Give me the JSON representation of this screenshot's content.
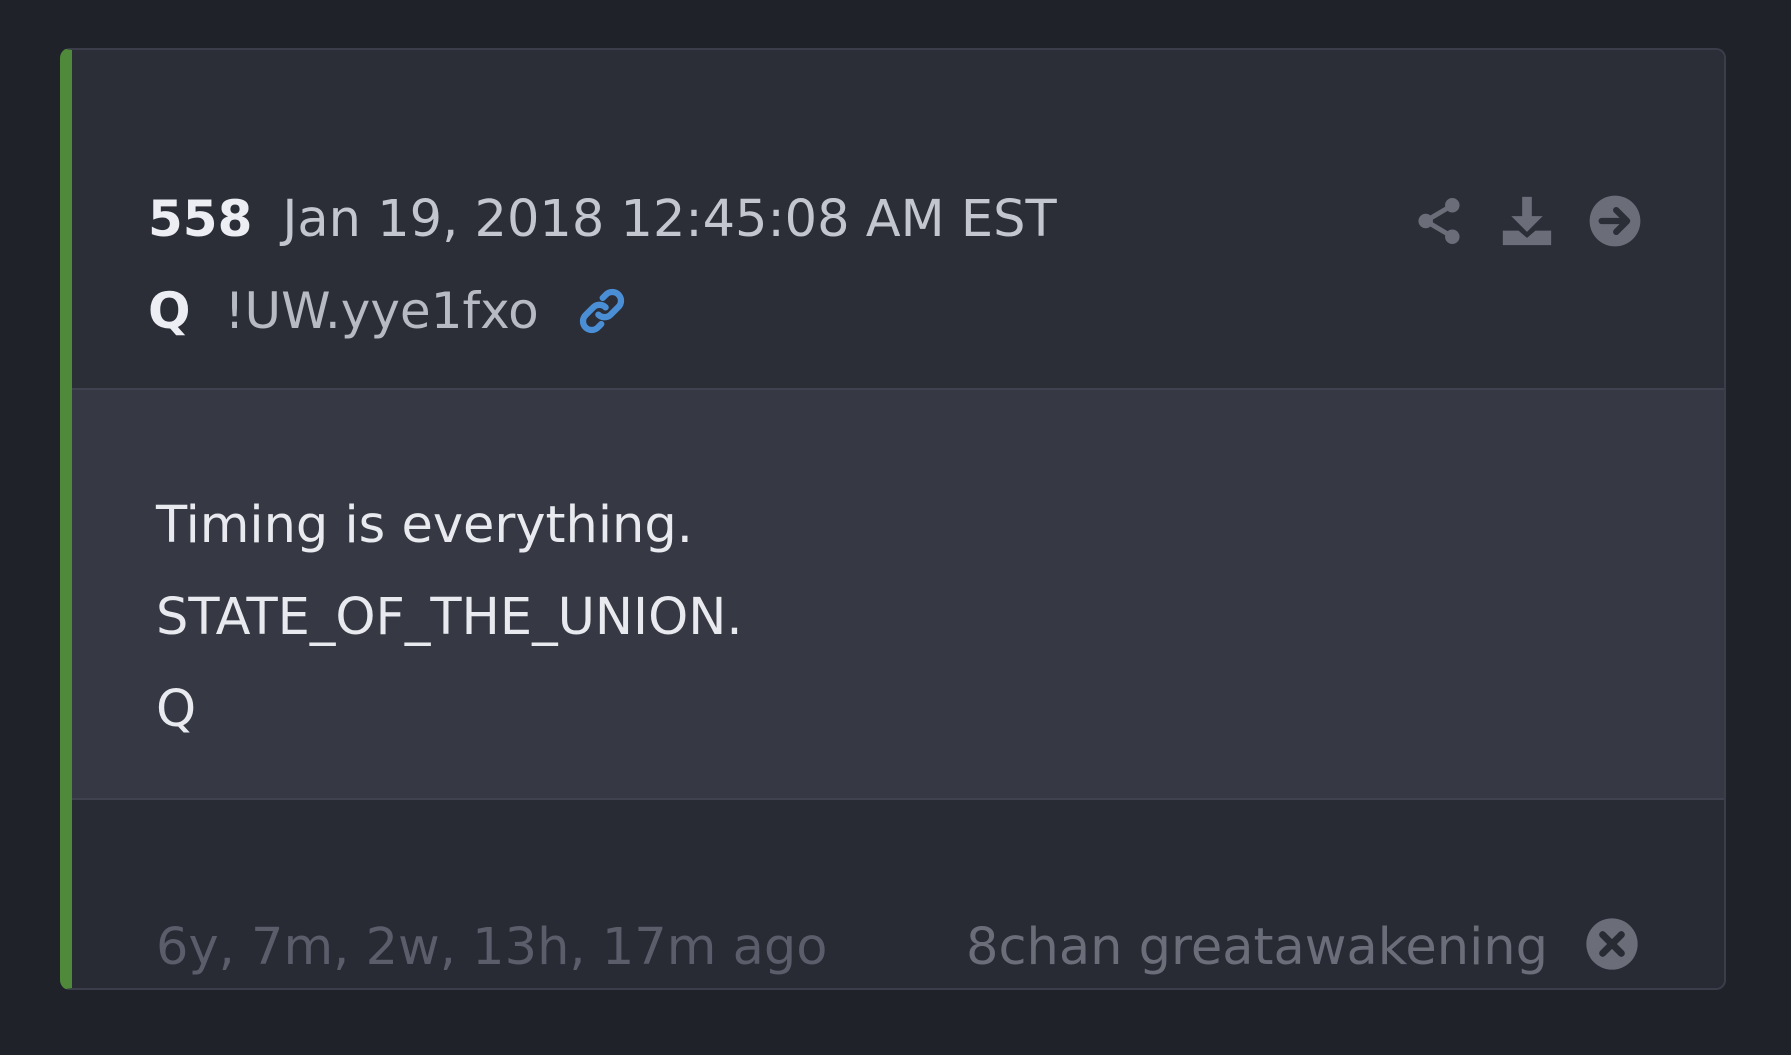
{
  "post": {
    "number": "558",
    "date": "Jan 19, 2018 12:45:08 AM EST",
    "author": "Q",
    "tripcode": "!UW.yye1fxo",
    "body_lines": [
      "Timing is everything.",
      "STATE_OF_THE_UNION.",
      "Q"
    ],
    "age": "6y, 7m, 2w, 13h, 17m ago",
    "source": "8chan greatawakening"
  },
  "icons": {
    "link": "link-icon",
    "share": "share-icon",
    "download": "download-icon",
    "goto": "arrow-right-circle-icon",
    "close": "close-circle-icon"
  },
  "colors": {
    "accent_bar": "#4f8a3b",
    "link": "#4a8fd6",
    "background": "#20222a"
  }
}
